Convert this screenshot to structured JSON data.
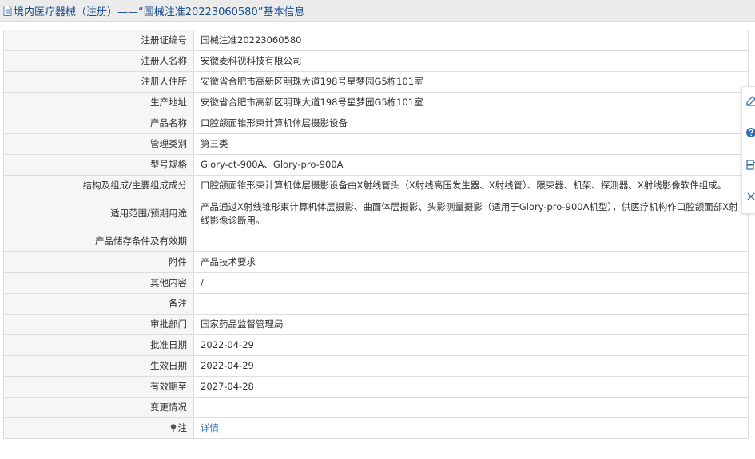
{
  "header": {
    "title": "境内医疗器械（注册）——“国械注准20223060580”基本信息"
  },
  "rows": [
    {
      "label": "注册证编号",
      "value": "国械注准20223060580"
    },
    {
      "label": "注册人名称",
      "value": "安徽麦科视科技有限公司"
    },
    {
      "label": "注册人住所",
      "value": "安徽省合肥市高新区明珠大道198号星梦园G5栋101室"
    },
    {
      "label": "生产地址",
      "value": "安徽省合肥市高新区明珠大道198号星梦园G5栋101室"
    },
    {
      "label": "产品名称",
      "value": "口腔颌面锥形束计算机体层摄影设备"
    },
    {
      "label": "管理类别",
      "value": "第三类"
    },
    {
      "label": "型号规格",
      "value": "Glory-ct-900A、Glory-pro-900A"
    },
    {
      "label": "结构及组成/主要组成成分",
      "value": "口腔颌面锥形束计算机体层摄影设备由X射线管头（X射线高压发生器、X射线管）、限束器、机架、探测器、X射线影像软件组成。"
    },
    {
      "label": "适用范围/预期用途",
      "value": "产品通过X射线锥形束计算机体层摄影、曲面体层摄影、头影测量摄影（适用于Glory-pro-900A机型），供医疗机构作口腔颌面部X射线影像诊断用。"
    },
    {
      "label": "产品储存条件及有效期",
      "value": ""
    },
    {
      "label": "附件",
      "value": "产品技术要求"
    },
    {
      "label": "其他内容",
      "value": "/"
    },
    {
      "label": "备注",
      "value": ""
    },
    {
      "label": "审批部门",
      "value": "国家药品监督管理局"
    },
    {
      "label": "批准日期",
      "value": "2022-04-29"
    },
    {
      "label": "生效日期",
      "value": "2022-04-29"
    },
    {
      "label": "有效期至",
      "value": "2027-04-28"
    },
    {
      "label": "变更情况",
      "value": ""
    }
  ],
  "note_row": {
    "label": "注",
    "link": "详情"
  },
  "icons": {
    "title": "document-icon",
    "note": "pin-icon",
    "side_tools": [
      "edit-icon",
      "help-icon",
      "share-icon",
      "close-icon"
    ]
  },
  "colors": {
    "title_text": "#1a4f8b",
    "link": "#2f6fb0",
    "label_bg": "#f6f6f6"
  }
}
